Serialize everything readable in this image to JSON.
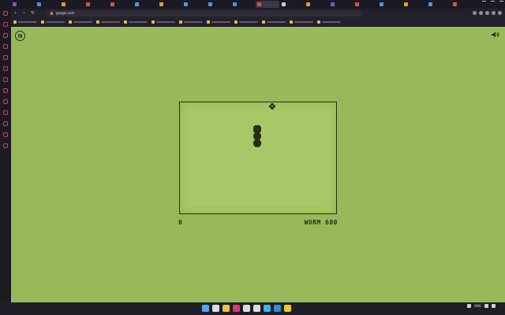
{
  "browser": {
    "url": "google.com",
    "tabs": [
      {
        "color": "#7b57d6",
        "active": false
      },
      {
        "color": "#4d8df5",
        "active": false
      },
      {
        "color": "#e0a020",
        "active": false
      },
      {
        "color": "#e84c3d",
        "active": false
      },
      {
        "color": "#e84c3d",
        "active": false
      },
      {
        "color": "#3aa0e8",
        "active": false
      },
      {
        "color": "#e0a020",
        "active": false
      },
      {
        "color": "#3aa0e8",
        "active": false
      },
      {
        "color": "#3aa0e8",
        "active": false
      },
      {
        "color": "#3aa0e8",
        "active": false
      },
      {
        "color": "#e84c3d",
        "active": true
      },
      {
        "color": "#cccccc",
        "active": false
      },
      {
        "color": "#e0a020",
        "active": false
      },
      {
        "color": "#7b57d6",
        "active": false
      },
      {
        "color": "#e84c3d",
        "active": false
      },
      {
        "color": "#3aa0e8",
        "active": false
      },
      {
        "color": "#e0a020",
        "active": false
      },
      {
        "color": "#4d8df5",
        "active": false
      },
      {
        "color": "#e84c3d",
        "active": false
      }
    ],
    "bookmarks": [
      {
        "color": "#d8c14c"
      },
      {
        "color": "#d8c14c"
      },
      {
        "color": "#d8c14c"
      },
      {
        "color": "#d8c14c"
      },
      {
        "color": "#d8c14c"
      },
      {
        "color": "#d8c14c"
      },
      {
        "color": "#d8c14c"
      },
      {
        "color": "#d8c14c"
      },
      {
        "color": "#d8c14c"
      },
      {
        "color": "#d8c14c"
      },
      {
        "color": "#d8c14c"
      },
      {
        "color": "#d8c14c"
      }
    ],
    "sidebar_icons": [
      "messenger-icon",
      "whatsapp-icon",
      "telegram-icon",
      "discord-icon",
      "instagram-icon",
      "vk-icon",
      "spotify-icon",
      "player-icon",
      "twitter-icon",
      "bookmarks-icon",
      "history-icon",
      "downloads-icon",
      "settings-icon"
    ]
  },
  "game": {
    "logo_letter": "N",
    "score": "0",
    "high_score_label": "WORM 600",
    "colors": {
      "background": "#99b85a",
      "board": "#a8c766",
      "ink": "#262d18"
    },
    "snake_length": 3,
    "food_icon": "flower-icon"
  },
  "taskbar": {
    "apps": [
      {
        "name": "windows-start-icon",
        "color": "#4aa8ff"
      },
      {
        "name": "search-icon",
        "color": "#dcdce6"
      },
      {
        "name": "file-explorer-icon",
        "color": "#f0c040"
      },
      {
        "name": "opera-gx-icon",
        "color": "#e3316f"
      },
      {
        "name": "store-icon",
        "color": "#dcdce6"
      },
      {
        "name": "photos-icon",
        "color": "#dcdce6"
      },
      {
        "name": "edge-icon",
        "color": "#3fb4e6"
      },
      {
        "name": "vscode-icon",
        "color": "#2f8be0"
      },
      {
        "name": "chrome-icon",
        "color": "#f4c430"
      }
    ],
    "language": "ENG"
  }
}
